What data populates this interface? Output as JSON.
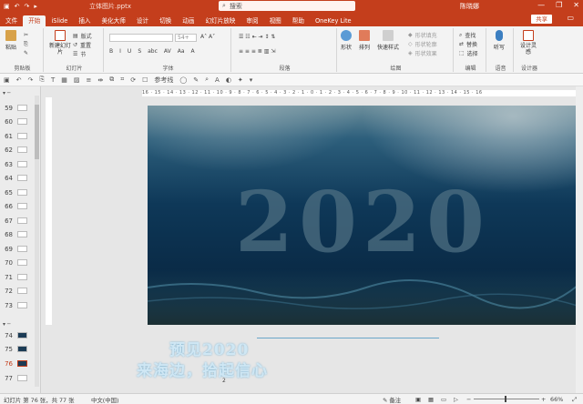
{
  "titlebar": {
    "file_name": "立体图片.pptx",
    "search_placeholder": "搜索",
    "user": "陈晓娜",
    "minimize": "—",
    "restore": "❐",
    "close": "✕"
  },
  "tabs": [
    "文件",
    "开始",
    "iSlide",
    "插入",
    "美化大师",
    "设计",
    "切换",
    "动画",
    "幻灯片放映",
    "审阅",
    "视图",
    "帮助",
    "OneKey Lite"
  ],
  "active_tab": "开始",
  "share_label": "共享",
  "ribbon": {
    "clipboard": {
      "paste": "粘贴",
      "label": "剪贴板"
    },
    "slides": {
      "new_slide": "新建幻灯片",
      "layout": "版式",
      "reset": "重置",
      "section": "节",
      "label": "幻灯片"
    },
    "font": {
      "font_name": "",
      "font_size": "54+",
      "label": "字体",
      "styles": [
        "B",
        "I",
        "U",
        "S",
        "abc",
        "AV",
        "Aa",
        "A"
      ]
    },
    "paragraph": {
      "label": "段落"
    },
    "drawing": {
      "shape": "形状",
      "arrange": "排列",
      "quick_styles": "快速样式",
      "fill": "形状填充",
      "outline": "形状轮廓",
      "effects": "形状效果",
      "label": "绘图"
    },
    "editing": {
      "find": "查找",
      "replace": "替换",
      "select": "选择",
      "label": "编辑"
    },
    "voice": {
      "dictate": "听写",
      "label": "语音"
    },
    "designer": {
      "design_ideas": "设计灵感",
      "label": "设计器"
    }
  },
  "qat": {
    "format_label": "参考线"
  },
  "slides_pane": {
    "items": [
      {
        "num": "59"
      },
      {
        "num": "60"
      },
      {
        "num": "61"
      },
      {
        "num": "62"
      },
      {
        "num": "63"
      },
      {
        "num": "64"
      },
      {
        "num": "65"
      },
      {
        "num": "66"
      },
      {
        "num": "67"
      },
      {
        "num": "68"
      },
      {
        "num": "69"
      },
      {
        "num": "70"
      },
      {
        "num": "71"
      },
      {
        "num": "72"
      },
      {
        "num": "73"
      },
      {
        "num": "74"
      },
      {
        "num": "75"
      },
      {
        "num": "76"
      },
      {
        "num": "77"
      }
    ],
    "selected": "76"
  },
  "ruler": {
    "text": "16 · 15 · 14 · 13 · 12 · 11 · 10 · 9 · 8 · 7 · 6 · 5 · 4 · 3 · 2 · 1 · 0 · 1 · 2 · 3 · 4 · 5 · 6 · 7 · 8 · 9 · 10 · 11 · 12 · 13 · 14 · 15 · 16"
  },
  "slide": {
    "big_text": "2020"
  },
  "caption": {
    "line1": "预见2020",
    "line2": "来海边，拾起信心"
  },
  "notes_marker": "2",
  "status": {
    "slide_info": "幻灯片 第 76 张，共 77 张",
    "language": "中文(中国)",
    "notes": "备注",
    "zoom": "66%"
  },
  "colors": {
    "accent": "#c43e1c",
    "sea_dark": "#0b2f4c",
    "sea_light": "#5a8fa8"
  }
}
